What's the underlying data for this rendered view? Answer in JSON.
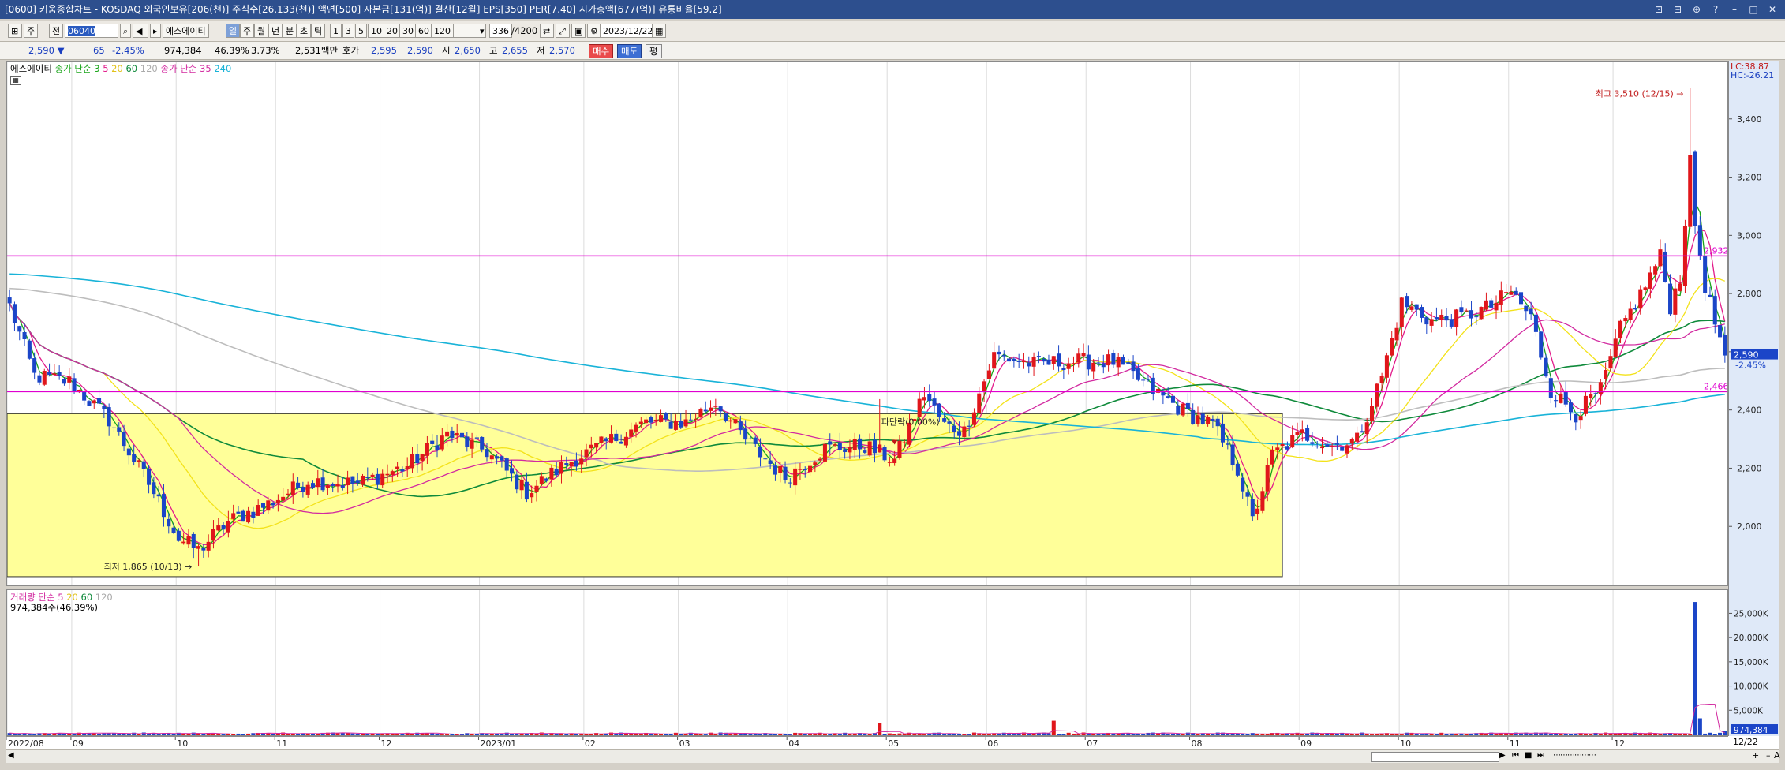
{
  "window": {
    "title": "[0600] 키움종합차트 - KOSDAQ 외국인보유[206(천)] 주식수[26,133(천)] 액면[500] 자본금[131(억)] 결산[12월] EPS[350] PER[7.40] 시가총액[677(억)] 유통비율[59.2]",
    "buttons": [
      "⊡",
      "⊟",
      "⊕",
      "?",
      "–",
      "□",
      "✕"
    ]
  },
  "toolbar": {
    "mode1": "주",
    "mode2": "전",
    "code": "06040",
    "name": "에스에이티",
    "periods": [
      "일",
      "주",
      "월",
      "년",
      "분",
      "초",
      "틱"
    ],
    "minutes": [
      "1",
      "3",
      "5",
      "10",
      "20",
      "30",
      "60",
      "120"
    ],
    "count": "336",
    "count_max": "/4200",
    "date": "2023/12/22"
  },
  "infobar": {
    "price": "2,590 ▼",
    "change": "65",
    "change_pct": "-2.45%",
    "volume": "974,384",
    "vol_ratio": "46.39%",
    "turnover": "3.73%",
    "amount": "2,531백만",
    "hoga_label": "호가",
    "hoga_ask": "2,595",
    "hoga_bid": "2,590",
    "open_label": "시",
    "open": "2,650",
    "high_label": "고",
    "high": "2,655",
    "low_label": "저",
    "low": "2,570",
    "buy": "매수",
    "sell": "매도",
    "eval": "평"
  },
  "price_legend": {
    "name": "에스에이티",
    "ma_group1": "종가 단순",
    "ma1": [
      "3",
      "5",
      "20",
      "60",
      "120"
    ],
    "ma_group2": "종가 단순",
    "ma2": [
      "35",
      "240"
    ]
  },
  "volume_legend": {
    "title": "거래량 단순",
    "ma": [
      "5",
      "20",
      "60",
      "120"
    ],
    "value": "974,384주(46.39%)"
  },
  "annotations": {
    "high": "최고 3,510 (12/15)",
    "low": "최저 1,865 (10/13)",
    "mid": "파단락(0.00%)",
    "lc": "LC:38.87",
    "hc": "HC:-26.21",
    "line_upper": "2,932",
    "line_lower": "2,466",
    "current_price": "2,590",
    "current_pct": "-2.45%",
    "current_vol": "974,384",
    "current_vol_pct": "46.39%"
  },
  "colors": {
    "up": "#e0161b",
    "down": "#1b45c8",
    "ma3": "#1aa51a",
    "ma5": "#e21a8a",
    "ma20": "#f3e21a",
    "ma60": "#0f8a3b",
    "ma120": "#bdbdbd",
    "ma35": "#d22aa0",
    "ma240": "#19b3d8",
    "hline": "#e000d0",
    "box": "#ffff99"
  },
  "chart_data": {
    "type": "candlestick",
    "price_axis": {
      "min": 1800,
      "max": 3600,
      "ticks": [
        "3,400",
        "3,200",
        "3,000",
        "2,800",
        "2,600",
        "2,400",
        "2,200",
        "2,000"
      ]
    },
    "volume_axis": {
      "max": 28000,
      "ticks": [
        "25,000K",
        "20,000K",
        "15,000K",
        "10,000K",
        "5,000K"
      ]
    },
    "x_labels": [
      "2022/08",
      "09",
      "10",
      "11",
      "12",
      "2023/01",
      "02",
      "03",
      "04",
      "05",
      "06",
      "07",
      "08",
      "09",
      "10",
      "11",
      "12",
      "12/22"
    ],
    "horizontal_lines": [
      2932,
      2466
    ],
    "close_anchors": [
      [
        0,
        2760
      ],
      [
        5,
        2520
      ],
      [
        12,
        2500
      ],
      [
        20,
        2370
      ],
      [
        28,
        2150
      ],
      [
        34,
        1960
      ],
      [
        38,
        1920
      ],
      [
        44,
        2020
      ],
      [
        52,
        2080
      ],
      [
        60,
        2160
      ],
      [
        70,
        2150
      ],
      [
        80,
        2210
      ],
      [
        88,
        2320
      ],
      [
        96,
        2260
      ],
      [
        104,
        2120
      ],
      [
        112,
        2220
      ],
      [
        120,
        2290
      ],
      [
        128,
        2360
      ],
      [
        136,
        2360
      ],
      [
        142,
        2430
      ],
      [
        148,
        2300
      ],
      [
        156,
        2170
      ],
      [
        164,
        2270
      ],
      [
        172,
        2280
      ],
      [
        178,
        2230
      ],
      [
        184,
        2460
      ],
      [
        188,
        2350
      ],
      [
        192,
        2330
      ],
      [
        198,
        2590
      ],
      [
        206,
        2560
      ],
      [
        214,
        2570
      ],
      [
        222,
        2570
      ],
      [
        230,
        2470
      ],
      [
        236,
        2400
      ],
      [
        242,
        2350
      ],
      [
        247,
        2200
      ],
      [
        250,
        2020
      ],
      [
        254,
        2250
      ],
      [
        260,
        2320
      ],
      [
        266,
        2280
      ],
      [
        271,
        2300
      ],
      [
        276,
        2520
      ],
      [
        280,
        2770
      ],
      [
        286,
        2710
      ],
      [
        292,
        2720
      ],
      [
        298,
        2760
      ],
      [
        302,
        2810
      ],
      [
        306,
        2720
      ],
      [
        310,
        2470
      ],
      [
        315,
        2390
      ],
      [
        320,
        2470
      ],
      [
        324,
        2680
      ],
      [
        328,
        2800
      ],
      [
        332,
        2930
      ],
      [
        334,
        2760
      ],
      [
        336,
        2860
      ],
      [
        338,
        3250
      ],
      [
        339,
        3040
      ],
      [
        341,
        2830
      ],
      [
        343,
        2700
      ],
      [
        345,
        2590
      ]
    ],
    "volume_spikes": [
      [
        175,
        2600
      ],
      [
        210,
        3000
      ],
      [
        339,
        27500
      ],
      [
        340,
        3500
      ]
    ],
    "ma_periods": [
      3,
      5,
      20,
      60,
      120,
      35,
      240
    ]
  }
}
